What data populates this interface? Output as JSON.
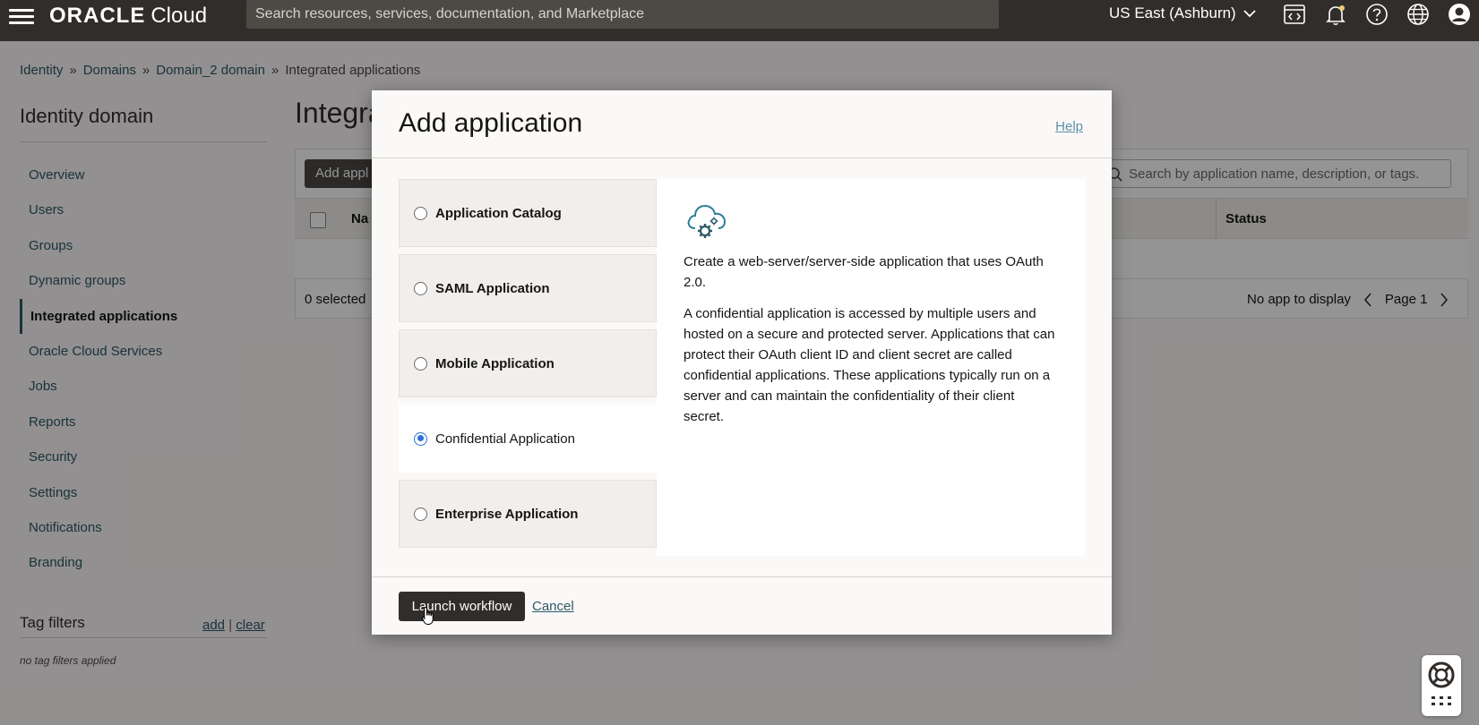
{
  "topbar": {
    "logo_brand": "ORACLE",
    "logo_product": "Cloud",
    "search_placeholder": "Search resources, services, documentation, and Marketplace",
    "region": "US East (Ashburn)"
  },
  "breadcrumb": [
    "Identity",
    "Domains",
    "Domain_2 domain",
    "Integrated applications"
  ],
  "sidebar": {
    "title": "Identity domain",
    "items": [
      {
        "label": "Overview"
      },
      {
        "label": "Users"
      },
      {
        "label": "Groups"
      },
      {
        "label": "Dynamic groups"
      },
      {
        "label": "Integrated applications",
        "active": true
      },
      {
        "label": "Oracle Cloud Services"
      },
      {
        "label": "Jobs"
      },
      {
        "label": "Reports"
      },
      {
        "label": "Security"
      },
      {
        "label": "Settings"
      },
      {
        "label": "Notifications"
      },
      {
        "label": "Branding"
      }
    ],
    "tag_filters": {
      "title": "Tag filters",
      "add": "add",
      "separator": "|",
      "clear": "clear",
      "empty": "no tag filters applied"
    }
  },
  "main": {
    "page_title": "Integra",
    "add_button": "Add appl",
    "search_placeholder": "Search by application name, description, or tags.",
    "columns": {
      "name": "Na",
      "status": "Status"
    },
    "selected": "0 selected",
    "pager": {
      "empty": "No app to display",
      "page": "Page 1"
    }
  },
  "dialog": {
    "title": "Add application",
    "help": "Help",
    "options": [
      {
        "label": "Application Catalog",
        "selected": false
      },
      {
        "label": "SAML Application",
        "selected": false
      },
      {
        "label": "Mobile Application",
        "selected": false
      },
      {
        "label": "Confidential Application",
        "selected": true
      },
      {
        "label": "Enterprise Application",
        "selected": false
      }
    ],
    "detail": {
      "icon": "cloud-gear-icon",
      "p1": "Create a web-server/server-side application that uses OAuth 2.0.",
      "p2": "A confidential application is accessed by multiple users and hosted on a secure and protected server. Applications that can protect their OAuth client ID and client secret are called confidential applications. These applications typically run on a server and can maintain the confidentiality of their client secret."
    },
    "launch_button": "Launch workflow",
    "cancel": "Cancel"
  },
  "colors": {
    "topbar": "#312d2a",
    "link": "#2d5967",
    "radio_selected": "#2e6fd8"
  }
}
